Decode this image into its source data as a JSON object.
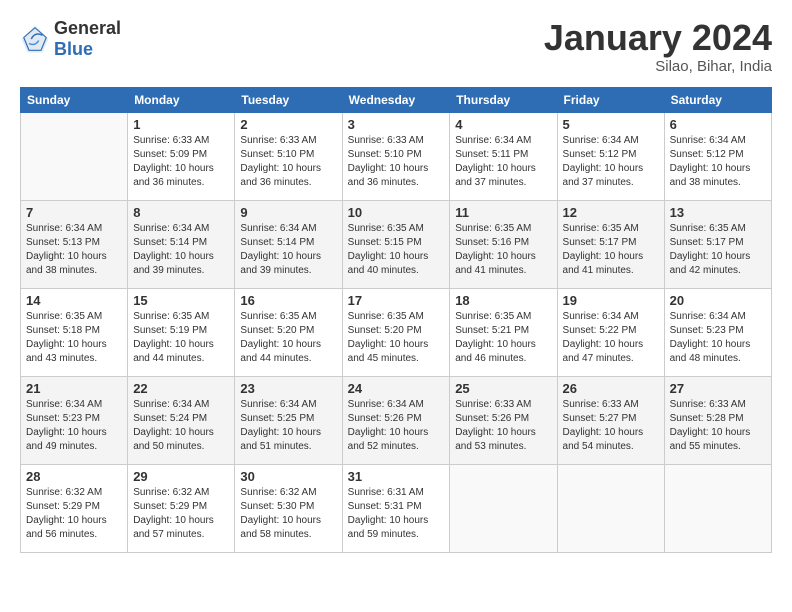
{
  "logo": {
    "general": "General",
    "blue": "Blue"
  },
  "header": {
    "month": "January 2024",
    "location": "Silao, Bihar, India"
  },
  "columns": [
    "Sunday",
    "Monday",
    "Tuesday",
    "Wednesday",
    "Thursday",
    "Friday",
    "Saturday"
  ],
  "weeks": [
    [
      {
        "day": "",
        "sunrise": "",
        "sunset": "",
        "daylight": ""
      },
      {
        "day": "1",
        "sunrise": "Sunrise: 6:33 AM",
        "sunset": "Sunset: 5:09 PM",
        "daylight": "Daylight: 10 hours and 36 minutes."
      },
      {
        "day": "2",
        "sunrise": "Sunrise: 6:33 AM",
        "sunset": "Sunset: 5:10 PM",
        "daylight": "Daylight: 10 hours and 36 minutes."
      },
      {
        "day": "3",
        "sunrise": "Sunrise: 6:33 AM",
        "sunset": "Sunset: 5:10 PM",
        "daylight": "Daylight: 10 hours and 36 minutes."
      },
      {
        "day": "4",
        "sunrise": "Sunrise: 6:34 AM",
        "sunset": "Sunset: 5:11 PM",
        "daylight": "Daylight: 10 hours and 37 minutes."
      },
      {
        "day": "5",
        "sunrise": "Sunrise: 6:34 AM",
        "sunset": "Sunset: 5:12 PM",
        "daylight": "Daylight: 10 hours and 37 minutes."
      },
      {
        "day": "6",
        "sunrise": "Sunrise: 6:34 AM",
        "sunset": "Sunset: 5:12 PM",
        "daylight": "Daylight: 10 hours and 38 minutes."
      }
    ],
    [
      {
        "day": "7",
        "sunrise": "Sunrise: 6:34 AM",
        "sunset": "Sunset: 5:13 PM",
        "daylight": "Daylight: 10 hours and 38 minutes."
      },
      {
        "day": "8",
        "sunrise": "Sunrise: 6:34 AM",
        "sunset": "Sunset: 5:14 PM",
        "daylight": "Daylight: 10 hours and 39 minutes."
      },
      {
        "day": "9",
        "sunrise": "Sunrise: 6:34 AM",
        "sunset": "Sunset: 5:14 PM",
        "daylight": "Daylight: 10 hours and 39 minutes."
      },
      {
        "day": "10",
        "sunrise": "Sunrise: 6:35 AM",
        "sunset": "Sunset: 5:15 PM",
        "daylight": "Daylight: 10 hours and 40 minutes."
      },
      {
        "day": "11",
        "sunrise": "Sunrise: 6:35 AM",
        "sunset": "Sunset: 5:16 PM",
        "daylight": "Daylight: 10 hours and 41 minutes."
      },
      {
        "day": "12",
        "sunrise": "Sunrise: 6:35 AM",
        "sunset": "Sunset: 5:17 PM",
        "daylight": "Daylight: 10 hours and 41 minutes."
      },
      {
        "day": "13",
        "sunrise": "Sunrise: 6:35 AM",
        "sunset": "Sunset: 5:17 PM",
        "daylight": "Daylight: 10 hours and 42 minutes."
      }
    ],
    [
      {
        "day": "14",
        "sunrise": "Sunrise: 6:35 AM",
        "sunset": "Sunset: 5:18 PM",
        "daylight": "Daylight: 10 hours and 43 minutes."
      },
      {
        "day": "15",
        "sunrise": "Sunrise: 6:35 AM",
        "sunset": "Sunset: 5:19 PM",
        "daylight": "Daylight: 10 hours and 44 minutes."
      },
      {
        "day": "16",
        "sunrise": "Sunrise: 6:35 AM",
        "sunset": "Sunset: 5:20 PM",
        "daylight": "Daylight: 10 hours and 44 minutes."
      },
      {
        "day": "17",
        "sunrise": "Sunrise: 6:35 AM",
        "sunset": "Sunset: 5:20 PM",
        "daylight": "Daylight: 10 hours and 45 minutes."
      },
      {
        "day": "18",
        "sunrise": "Sunrise: 6:35 AM",
        "sunset": "Sunset: 5:21 PM",
        "daylight": "Daylight: 10 hours and 46 minutes."
      },
      {
        "day": "19",
        "sunrise": "Sunrise: 6:34 AM",
        "sunset": "Sunset: 5:22 PM",
        "daylight": "Daylight: 10 hours and 47 minutes."
      },
      {
        "day": "20",
        "sunrise": "Sunrise: 6:34 AM",
        "sunset": "Sunset: 5:23 PM",
        "daylight": "Daylight: 10 hours and 48 minutes."
      }
    ],
    [
      {
        "day": "21",
        "sunrise": "Sunrise: 6:34 AM",
        "sunset": "Sunset: 5:23 PM",
        "daylight": "Daylight: 10 hours and 49 minutes."
      },
      {
        "day": "22",
        "sunrise": "Sunrise: 6:34 AM",
        "sunset": "Sunset: 5:24 PM",
        "daylight": "Daylight: 10 hours and 50 minutes."
      },
      {
        "day": "23",
        "sunrise": "Sunrise: 6:34 AM",
        "sunset": "Sunset: 5:25 PM",
        "daylight": "Daylight: 10 hours and 51 minutes."
      },
      {
        "day": "24",
        "sunrise": "Sunrise: 6:34 AM",
        "sunset": "Sunset: 5:26 PM",
        "daylight": "Daylight: 10 hours and 52 minutes."
      },
      {
        "day": "25",
        "sunrise": "Sunrise: 6:33 AM",
        "sunset": "Sunset: 5:26 PM",
        "daylight": "Daylight: 10 hours and 53 minutes."
      },
      {
        "day": "26",
        "sunrise": "Sunrise: 6:33 AM",
        "sunset": "Sunset: 5:27 PM",
        "daylight": "Daylight: 10 hours and 54 minutes."
      },
      {
        "day": "27",
        "sunrise": "Sunrise: 6:33 AM",
        "sunset": "Sunset: 5:28 PM",
        "daylight": "Daylight: 10 hours and 55 minutes."
      }
    ],
    [
      {
        "day": "28",
        "sunrise": "Sunrise: 6:32 AM",
        "sunset": "Sunset: 5:29 PM",
        "daylight": "Daylight: 10 hours and 56 minutes."
      },
      {
        "day": "29",
        "sunrise": "Sunrise: 6:32 AM",
        "sunset": "Sunset: 5:29 PM",
        "daylight": "Daylight: 10 hours and 57 minutes."
      },
      {
        "day": "30",
        "sunrise": "Sunrise: 6:32 AM",
        "sunset": "Sunset: 5:30 PM",
        "daylight": "Daylight: 10 hours and 58 minutes."
      },
      {
        "day": "31",
        "sunrise": "Sunrise: 6:31 AM",
        "sunset": "Sunset: 5:31 PM",
        "daylight": "Daylight: 10 hours and 59 minutes."
      },
      {
        "day": "",
        "sunrise": "",
        "sunset": "",
        "daylight": ""
      },
      {
        "day": "",
        "sunrise": "",
        "sunset": "",
        "daylight": ""
      },
      {
        "day": "",
        "sunrise": "",
        "sunset": "",
        "daylight": ""
      }
    ]
  ]
}
